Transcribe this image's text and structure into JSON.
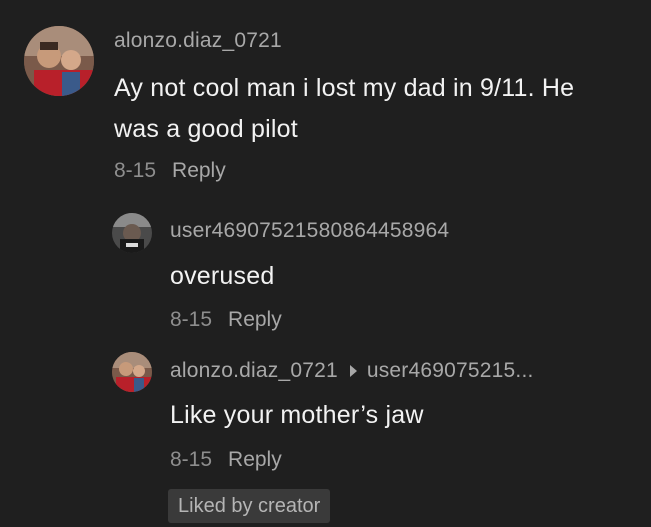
{
  "comments": [
    {
      "username": "alonzo.diaz_0721",
      "text_line1": "Ay not cool man i lost my dad in 9/11. He",
      "text_line2": "was a good pilot",
      "date": "8-15",
      "reply_label": "Reply"
    },
    {
      "username": "user46907521580864458964",
      "text": "overused",
      "date": "8-15",
      "reply_label": "Reply"
    },
    {
      "username": "alonzo.diaz_0721",
      "reply_to": "user469075215...",
      "text": "Like your mother’s jaw",
      "date": "8-15",
      "reply_label": "Reply",
      "badge": "Liked by creator"
    }
  ],
  "colors": {
    "background": "#1f1f1f",
    "username": "#a8a8a8",
    "text": "#f2f2f2",
    "meta": "#8e8e8e",
    "badge_bg": "#3a3a3a"
  },
  "icons": {
    "reply_arrow": "triangle-right-icon"
  }
}
